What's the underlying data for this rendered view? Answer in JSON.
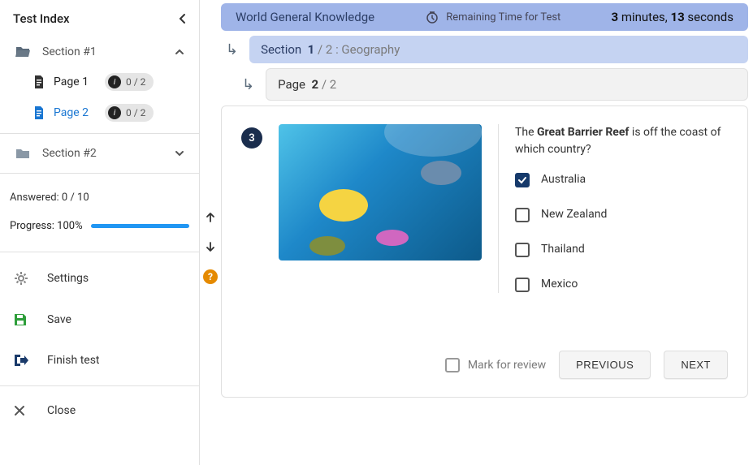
{
  "sidebar": {
    "title": "Test Index",
    "sections": [
      {
        "label": "Section #1",
        "expanded": true,
        "pages": [
          {
            "label": "Page 1",
            "score": "0 / 2",
            "active": false
          },
          {
            "label": "Page 2",
            "score": "0 / 2",
            "active": true
          }
        ]
      },
      {
        "label": "Section #2",
        "expanded": false,
        "pages": []
      }
    ],
    "answered_label": "Answered: 0 / 10",
    "progress_label": "Progress: 100%",
    "menu": {
      "settings": "Settings",
      "save": "Save",
      "finish": "Finish test",
      "close": "Close"
    }
  },
  "test": {
    "title": "World General Knowledge",
    "remaining_label": "Remaining Time for Test",
    "timer_minutes": "3",
    "timer_minutes_word": " minutes, ",
    "timer_seconds": "13",
    "timer_seconds_word": " seconds"
  },
  "breadcrumb": {
    "section_word": "Section",
    "section_num": "1",
    "section_total": "/ 2 ",
    "section_name": ": Geography",
    "page_word": "Page",
    "page_num": "2",
    "page_total": "/ 2"
  },
  "question": {
    "number": "3",
    "prompt_pre": "The ",
    "prompt_bold": "Great Barrier Reef",
    "prompt_post": " is off the coast of which country?",
    "options": [
      {
        "label": "Australia",
        "checked": true
      },
      {
        "label": "New Zealand",
        "checked": false
      },
      {
        "label": "Thailand",
        "checked": false
      },
      {
        "label": "Mexico",
        "checked": false
      }
    ]
  },
  "footer": {
    "mark_label": "Mark for review",
    "prev": "PREVIOUS",
    "next": "NEXT"
  }
}
